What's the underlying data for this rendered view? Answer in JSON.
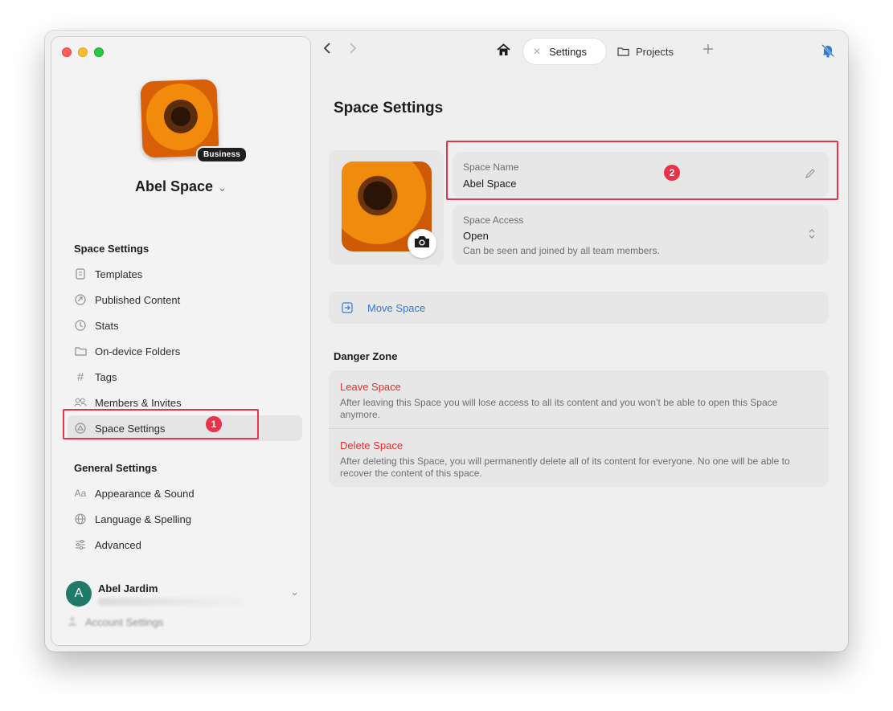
{
  "window": {
    "traffic_lights": [
      "close",
      "minimize",
      "zoom"
    ]
  },
  "sidebar": {
    "badge": "Business",
    "space_name": "Abel Space",
    "space_settings_title": "Space Settings",
    "space_items": [
      {
        "label": "Templates",
        "icon": "template-icon"
      },
      {
        "label": "Published Content",
        "icon": "published-icon"
      },
      {
        "label": "Stats",
        "icon": "stats-icon"
      },
      {
        "label": "On-device Folders",
        "icon": "folder-icon"
      },
      {
        "label": "Tags",
        "icon": "hash-icon"
      },
      {
        "label": "Members & Invites",
        "icon": "members-icon"
      },
      {
        "label": "Space Settings",
        "icon": "settings-icon",
        "active": true
      }
    ],
    "general_settings_title": "General Settings",
    "general_items": [
      {
        "label": "Appearance & Sound",
        "icon": "text-aa-icon"
      },
      {
        "label": "Language & Spelling",
        "icon": "globe-icon"
      },
      {
        "label": "Advanced",
        "icon": "sliders-icon"
      }
    ],
    "user": {
      "initial": "A",
      "name": "Abel Jardim"
    },
    "account_settings": "Account Settings"
  },
  "topbar": {
    "tabs": [
      {
        "label": "Settings",
        "active": true
      },
      {
        "label": "Projects",
        "active": false
      }
    ]
  },
  "main": {
    "title": "Space Settings",
    "space_name_field": {
      "label": "Space Name",
      "value": "Abel Space"
    },
    "space_access_field": {
      "label": "Space Access",
      "value": "Open",
      "description": "Can be seen and joined by all team members."
    },
    "move_space": "Move Space",
    "danger_zone_title": "Danger Zone",
    "leave_space": {
      "title": "Leave Space",
      "description": "After leaving this Space you will lose access to all its content and you won’t be able to open this Space anymore."
    },
    "delete_space": {
      "title": "Delete Space",
      "description": "After deleting this Space, you will permanently delete all of its content for everyone. No one will be able to recover the content of this space."
    }
  },
  "annotations": [
    {
      "number": "1"
    },
    {
      "number": "2"
    }
  ],
  "colors": {
    "accent_link": "#2f7bd8",
    "danger": "#e0302c",
    "annotation": "#e8334a",
    "user_avatar": "#1f7a69"
  }
}
